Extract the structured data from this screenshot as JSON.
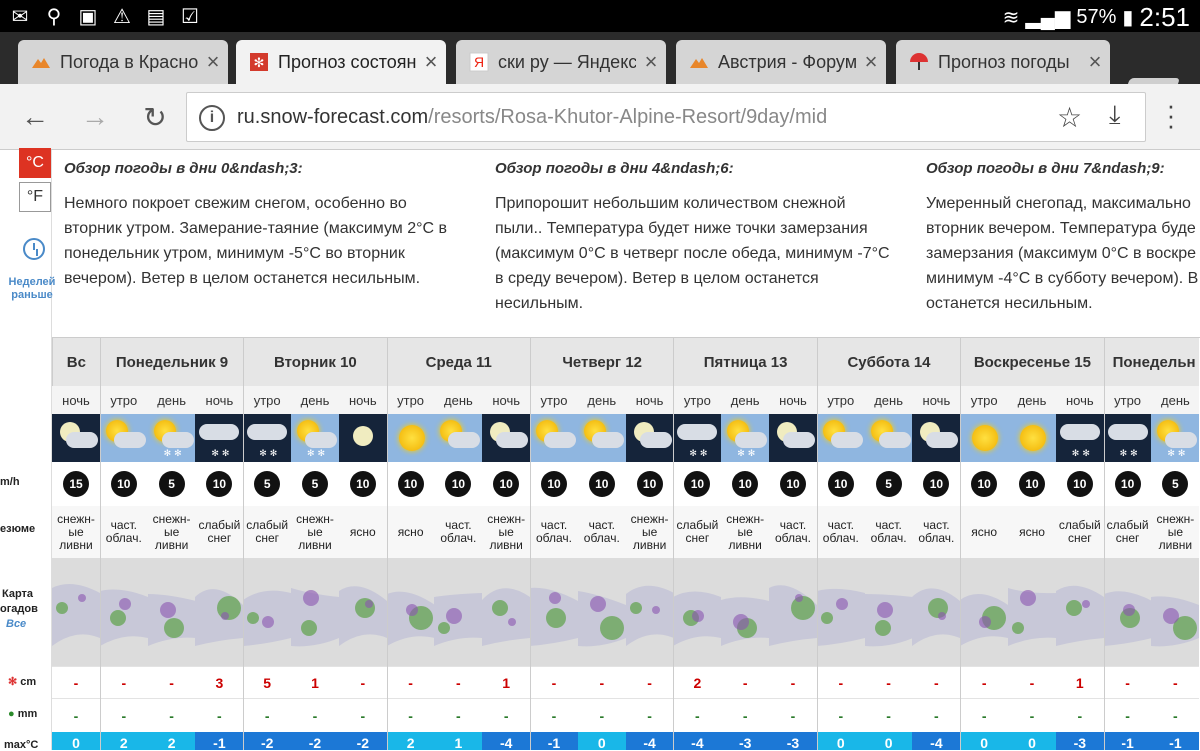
{
  "status": {
    "battery": "57%",
    "time": "2:51"
  },
  "tabs": [
    {
      "title": "Погода в Красно"
    },
    {
      "title": "Прогноз состоян"
    },
    {
      "title": "ски ру — Яндекс"
    },
    {
      "title": "Австрия - Форум"
    },
    {
      "title": "Прогноз погоды"
    }
  ],
  "url": {
    "domain": "ru.snow-forecast.com",
    "path": "/resorts/Rosa-Khutor-Alpine-Resort/9day/mid"
  },
  "sidebar": {
    "unit_c": "°C",
    "unit_f": "°F",
    "weeks_earlier": "Неделей раньше",
    "wind_label": "m/h",
    "summary_label": "езюме",
    "map_label": "Карта",
    "map_label2": "огадов",
    "map_all": "Все",
    "snow_label": "cm",
    "rain_label": "mm",
    "temp_label": "max°C"
  },
  "summaries": [
    {
      "title": "Обзор погоды в дни 0&ndash;3:",
      "lines": [
        "Немного покроет свежим снегом, особенно во",
        "вторник утром. Замерание-таяние (максимум 2°C в",
        "понедельник утром, минимум -5°C во вторник",
        "вечером). Ветер в целом останется несильным."
      ]
    },
    {
      "title": "Обзор погоды в дни 4&ndash;6:",
      "lines": [
        "Припорошит небольшим количеством снежной",
        "пыли.. Температура будет ниже точки замерзания",
        "(максимум 0°C в четверг после обеда, минимум -7°C",
        "в среду вечером). Ветер в целом останется",
        "несильным."
      ]
    },
    {
      "title": "Обзор погоды в дни 7&ndash;9:",
      "lines": [
        "Умеренный снегопад, максимально",
        "вторник вечером. Температура буде",
        "замерзания (максимум 0°C в воскре",
        "минимум -4°C в субботу вечером). В",
        "останется несильным."
      ]
    }
  ],
  "days": [
    "Вс",
    "Понедельник 9",
    "Вторник 10",
    "Среда 11",
    "Четверг 12",
    "Пятница 13",
    "Суббота 14",
    "Воскресенье 15",
    "Понедельн"
  ],
  "periods": [
    "ночь",
    "утро",
    "день",
    "ночь",
    "утро",
    "день",
    "ночь",
    "утро",
    "день",
    "ночь",
    "утро",
    "день",
    "ночь",
    "утро",
    "день",
    "ночь",
    "утро",
    "день",
    "ночь",
    "утро",
    "день",
    "ночь",
    "утро",
    "день"
  ],
  "icons": [
    "moon-cloud-icon",
    "sun-cloud-icon",
    "sun-cloud-snow-icon",
    "cloud-snow-icon",
    "cloud-snow-icon",
    "sun-cloud-snow-icon",
    "moon-icon",
    "sun-icon",
    "sun-cloud-icon",
    "moon-cloud-icon",
    "sun-cloud-icon",
    "sun-cloud-icon",
    "moon-cloud-icon",
    "cloud-snow-icon",
    "sun-cloud-snow-icon",
    "moon-cloud-icon",
    "sun-cloud-icon",
    "sun-cloud-icon",
    "moon-cloud-icon",
    "sun-icon",
    "sun-icon",
    "cloud-snow-icon",
    "cloud-snow-icon",
    "sun-cloud-snow-icon"
  ],
  "wind": [
    "15",
    "10",
    "5",
    "10",
    "5",
    "5",
    "10",
    "10",
    "10",
    "10",
    "10",
    "10",
    "10",
    "10",
    "10",
    "10",
    "10",
    "5",
    "10",
    "10",
    "10",
    "10",
    "10",
    "5"
  ],
  "weather": [
    [
      "снежн-",
      "ые",
      "ливни"
    ],
    [
      "част.",
      "облач."
    ],
    [
      "снежн-",
      "ые",
      "ливни"
    ],
    [
      "слабый",
      "снег"
    ],
    [
      "слабый",
      "снег"
    ],
    [
      "снежн-",
      "ые",
      "ливни"
    ],
    [
      "ясно"
    ],
    [
      "ясно"
    ],
    [
      "част.",
      "облач."
    ],
    [
      "снежн-",
      "ые",
      "ливни"
    ],
    [
      "част.",
      "облач."
    ],
    [
      "част.",
      "облач."
    ],
    [
      "снежн-",
      "ые",
      "ливни"
    ],
    [
      "слабый",
      "снег"
    ],
    [
      "снежн-",
      "ые",
      "ливни"
    ],
    [
      "част.",
      "облач."
    ],
    [
      "част.",
      "облач."
    ],
    [
      "част.",
      "облач."
    ],
    [
      "част.",
      "облач."
    ],
    [
      "ясно"
    ],
    [
      "ясно"
    ],
    [
      "слабый",
      "снег"
    ],
    [
      "слабый",
      "снег"
    ],
    [
      "снежн-",
      "ые",
      "ливни"
    ]
  ],
  "snow": [
    "-",
    "-",
    "-",
    "3",
    "5",
    "1",
    "-",
    "-",
    "-",
    "1",
    "-",
    "-",
    "-",
    "2",
    "-",
    "-",
    "-",
    "-",
    "-",
    "-",
    "-",
    "1",
    "-",
    "-"
  ],
  "rain": [
    "-",
    "-",
    "-",
    "-",
    "-",
    "-",
    "-",
    "-",
    "-",
    "-",
    "-",
    "-",
    "-",
    "-",
    "-",
    "-",
    "-",
    "-",
    "-",
    "-",
    "-",
    "-",
    "-",
    "-"
  ],
  "temp": [
    "0",
    "2",
    "2",
    "-1",
    "-2",
    "-2",
    "-2",
    "2",
    "1",
    "-4",
    "-1",
    "0",
    "-4",
    "-4",
    "-3",
    "-3",
    "0",
    "0",
    "-4",
    "0",
    "0",
    "-3",
    "-1",
    "-1"
  ],
  "colors": {
    "accent": "#d33a2c",
    "link": "#4a8ac8",
    "snow_text": "#c00000",
    "rain_text": "#2a7a2a",
    "temp_warm": "#19b7e8",
    "temp_cold": "#1c78d6"
  }
}
